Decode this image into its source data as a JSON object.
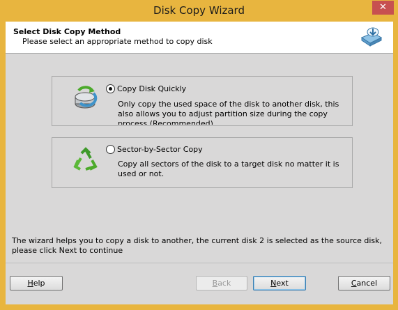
{
  "window": {
    "title": "Disk Copy Wizard",
    "close_glyph": "✕",
    "frame_color": "#e8b53f",
    "close_color": "#c75050"
  },
  "header": {
    "title": "Select Disk Copy Method",
    "subtitle": "Please select an appropriate method to copy disk",
    "icon": "disk-copy-icon"
  },
  "options": [
    {
      "label": "Copy Disk Quickly",
      "selected": true,
      "icon": "quick-copy-icon",
      "description": "Only copy the used space of the disk to another disk, this also allows you to adjust partition size during the copy process.(Recommended)"
    },
    {
      "label": "Sector-by-Sector Copy",
      "selected": false,
      "icon": "recycle-icon",
      "description": "Copy all sectors of the disk to a target disk no matter it is used or not."
    }
  ],
  "info": "The wizard helps you to copy a disk to another, the current disk 2 is selected as the source disk, please click Next to continue",
  "buttons": {
    "help_first": "H",
    "help_rest": "elp",
    "back_first": "B",
    "back_rest": "ack",
    "next_first": "N",
    "next_rest": "ext",
    "cancel_first": "C",
    "cancel_rest": "ancel"
  }
}
